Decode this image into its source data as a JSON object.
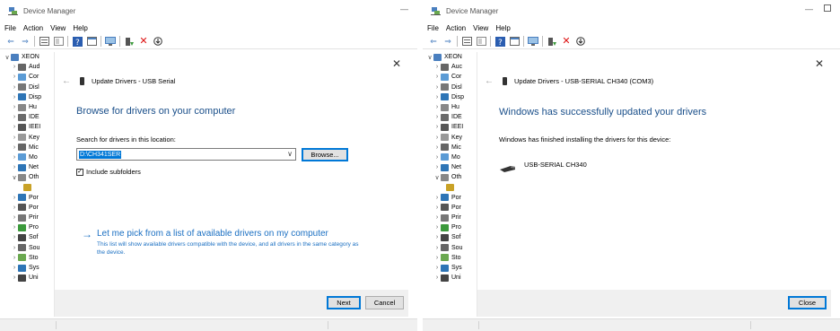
{
  "left": {
    "title": "Device Manager",
    "menu": [
      "File",
      "Action",
      "View",
      "Help"
    ],
    "tree": {
      "root": "XEON",
      "children": [
        "Aud",
        "Cor",
        "Disl",
        "Disp",
        "Hu",
        "IDE",
        "IEEI",
        "Key",
        "Mic",
        "Mo",
        "Net",
        "Oth",
        "",
        "Por",
        "Por",
        "Prir",
        "Pro",
        "Sof",
        "Sou",
        "Sto",
        "Sys",
        "Uni"
      ]
    },
    "dialog": {
      "header": "Update Drivers - USB Serial",
      "heading": "Browse for drivers on your computer",
      "search_label": "Search for drivers in this location:",
      "path_value": "D:\\CH341SER",
      "browse_label": "Browse...",
      "include_subfolders": "Include subfolders",
      "link_title": "Let me pick from a list of available drivers on my computer",
      "link_desc": "This list will show available drivers compatible with the device, and all drivers in the same category as the device.",
      "next_label": "Next",
      "cancel_label": "Cancel"
    }
  },
  "right": {
    "title": "Device Manager",
    "menu": [
      "File",
      "Action",
      "View",
      "Help"
    ],
    "tree": {
      "root": "XEON",
      "children": [
        "Auc",
        "Cor",
        "Disl",
        "Disp",
        "Hu",
        "IDE",
        "IEEI",
        "Key",
        "Mic",
        "Mo",
        "Net",
        "Oth",
        "",
        "Por",
        "Por",
        "Prir",
        "Pro",
        "Sof",
        "Sou",
        "Sto",
        "Sys",
        "Uni"
      ]
    },
    "dialog": {
      "header": "Update Drivers - USB-SERIAL CH340 (COM3)",
      "heading": "Windows has successfully updated your drivers",
      "finished_text": "Windows has finished installing the drivers for this device:",
      "device_name": "USB-SERIAL CH340",
      "close_label": "Close"
    }
  },
  "colors": {
    "accent": "#0078d7",
    "heading_blue": "#1a4f8a",
    "link_blue": "#1a6fc2",
    "footer_bg": "#f0f0f0"
  }
}
